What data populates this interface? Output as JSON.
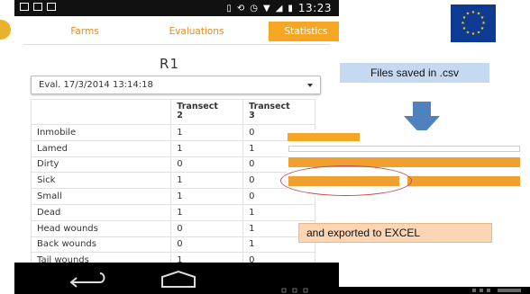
{
  "phone": {
    "status_time": "13:23",
    "tabs": [
      {
        "label": "Farms",
        "active": false
      },
      {
        "label": "Evaluations",
        "active": false
      },
      {
        "label": "Statistics",
        "active": true
      }
    ],
    "title": "R1",
    "evaluation_select": {
      "value": "Eval. 17/3/2014 13:14:18"
    },
    "table": {
      "headers": [
        "",
        "Transect\n2",
        "Transect\n3"
      ],
      "header_col1_line1": "Transect",
      "header_col1_line2": "2",
      "header_col2_line1": "Transect",
      "header_col2_line2": "3",
      "rows": [
        {
          "name": "Inmobile",
          "t2": "1",
          "t3": "0"
        },
        {
          "name": "Lamed",
          "t2": "1",
          "t3": "1"
        },
        {
          "name": "Dirty",
          "t2": "0",
          "t3": "0"
        },
        {
          "name": "Sick",
          "t2": "1",
          "t3": "0"
        },
        {
          "name": "Small",
          "t2": "1",
          "t3": "0"
        },
        {
          "name": "Dead",
          "t2": "1",
          "t3": "1"
        },
        {
          "name": "Head wounds",
          "t2": "0",
          "t3": "1"
        },
        {
          "name": "Back wounds",
          "t2": "0",
          "t3": "1"
        },
        {
          "name": "Tail wounds",
          "t2": "1",
          "t3": "0"
        }
      ]
    },
    "icons": [
      "back-icon",
      "home-icon"
    ]
  },
  "callouts": {
    "files_saved": "Files saved in .csv",
    "exported": "and  exported to EXCEL"
  },
  "colors": {
    "accent_orange": "#f5a623",
    "tab_text_orange": "#e98a1c",
    "files_box_blue": "#c5d9f1",
    "excel_box_peach": "#fcd5b4",
    "arrow_blue": "#4f81bd",
    "eu_blue": "#0d3b93",
    "eu_star": "#ffcc00"
  }
}
